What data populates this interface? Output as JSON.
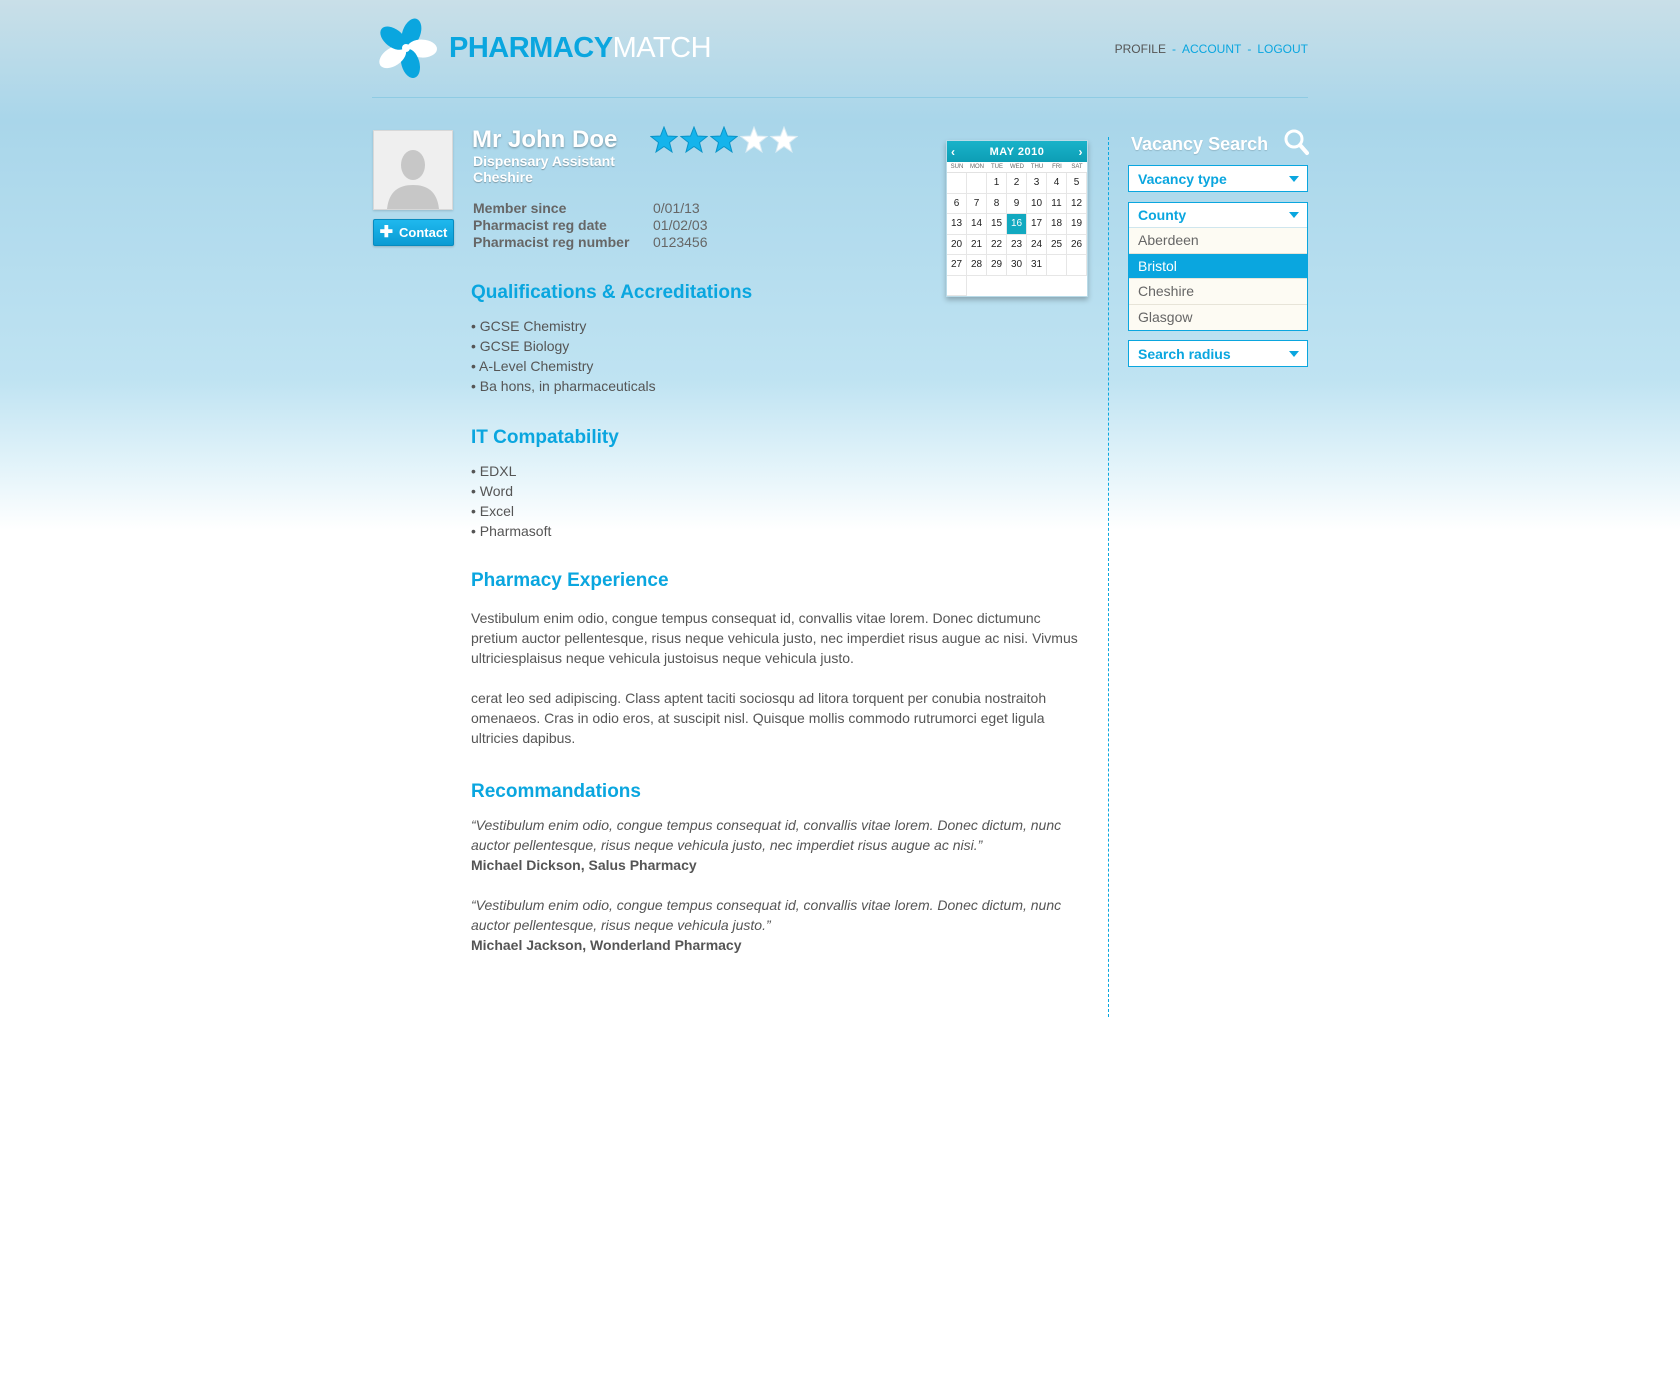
{
  "header": {
    "brand_strong": "PHARMACY",
    "brand_light": "MATCH",
    "nav": {
      "profile": "PROFILE",
      "account": "ACCOUNT",
      "logout": "LOGOUT",
      "separator": "-"
    }
  },
  "profile": {
    "name": "Mr John Doe",
    "role": "Dispensary Assistant",
    "location": "Cheshire",
    "rating": 3,
    "rating_max": 5,
    "contact_label": "Contact",
    "meta": [
      {
        "label": "Member since",
        "value": "0/01/13"
      },
      {
        "label": "Pharmacist reg date",
        "value": "01/02/03"
      },
      {
        "label": "Pharmacist reg number",
        "value": "0123456"
      }
    ]
  },
  "calendar": {
    "title": "MAY 2010",
    "days_of_week": [
      "SUN",
      "MON",
      "TUE",
      "WED",
      "THU",
      "FRI",
      "SAT"
    ],
    "cells": [
      "",
      "",
      "1",
      "2",
      "3",
      "4",
      "5",
      "6",
      "7",
      "8",
      "9",
      "10",
      "11",
      "12",
      "13",
      "14",
      "15",
      "16",
      "17",
      "18",
      "19",
      "20",
      "21",
      "22",
      "23",
      "24",
      "25",
      "26",
      "27",
      "28",
      "29",
      "30",
      "31",
      "",
      "",
      ""
    ],
    "today": "16"
  },
  "sections": {
    "qualifications": {
      "title": "Qualifications & Accreditations",
      "items": [
        "• GCSE Chemistry",
        "• GCSE Biology",
        "• A-Level Chemistry",
        "• Ba hons, in pharmaceuticals"
      ]
    },
    "it": {
      "title": "IT Compatability",
      "items": [
        "• EDXL",
        "• Word",
        "• Excel",
        "• Pharmasoft"
      ]
    },
    "experience": {
      "title": "Pharmacy Experience",
      "paragraphs": [
        "Vestibulum enim odio, congue tempus consequat id, convallis vitae lorem. Donec dictumunc pretium auctor pellentesque, risus neque vehicula justo, nec imperdiet risus augue ac nisi. Vivmus ultriciesplaisus neque vehicula justoisus neque vehicula justo.",
        "cerat leo sed adipiscing. Class aptent taciti sociosqu ad litora torquent per conubia nostraitoh omenaeos. Cras in odio eros, at suscipit nisl. Quisque mollis commodo rutrumorci eget ligula ultricies dapibus."
      ]
    },
    "recommendations": {
      "title": "Recommandations",
      "items": [
        {
          "quote": "“Vestibulum enim odio, congue tempus consequat id, convallis vitae lorem. Donec dictum, nunc auctor pellentesque, risus neque vehicula justo, nec imperdiet risus augue ac nisi.”",
          "author": "Michael Dickson, Salus Pharmacy"
        },
        {
          "quote": "“Vestibulum enim odio, congue tempus consequat id, convallis vitae lorem. Donec dictum, nunc auctor pellentesque, risus neque vehicula justo.”",
          "author": "Michael Jackson, Wonderland Pharmacy"
        }
      ]
    }
  },
  "sidebar": {
    "title": "Vacancy Search",
    "search_icon": "search-icon",
    "vacancy_type": "Vacancy type",
    "county": {
      "label": "County",
      "options": [
        "Aberdeen",
        "Bristol",
        "Cheshire",
        "Glasgow"
      ],
      "selected": "Bristol"
    },
    "search_radius": "Search radius"
  },
  "colors": {
    "accent": "#0aa6df",
    "calendar_accent": "#12a9c0",
    "text": "#555555"
  }
}
